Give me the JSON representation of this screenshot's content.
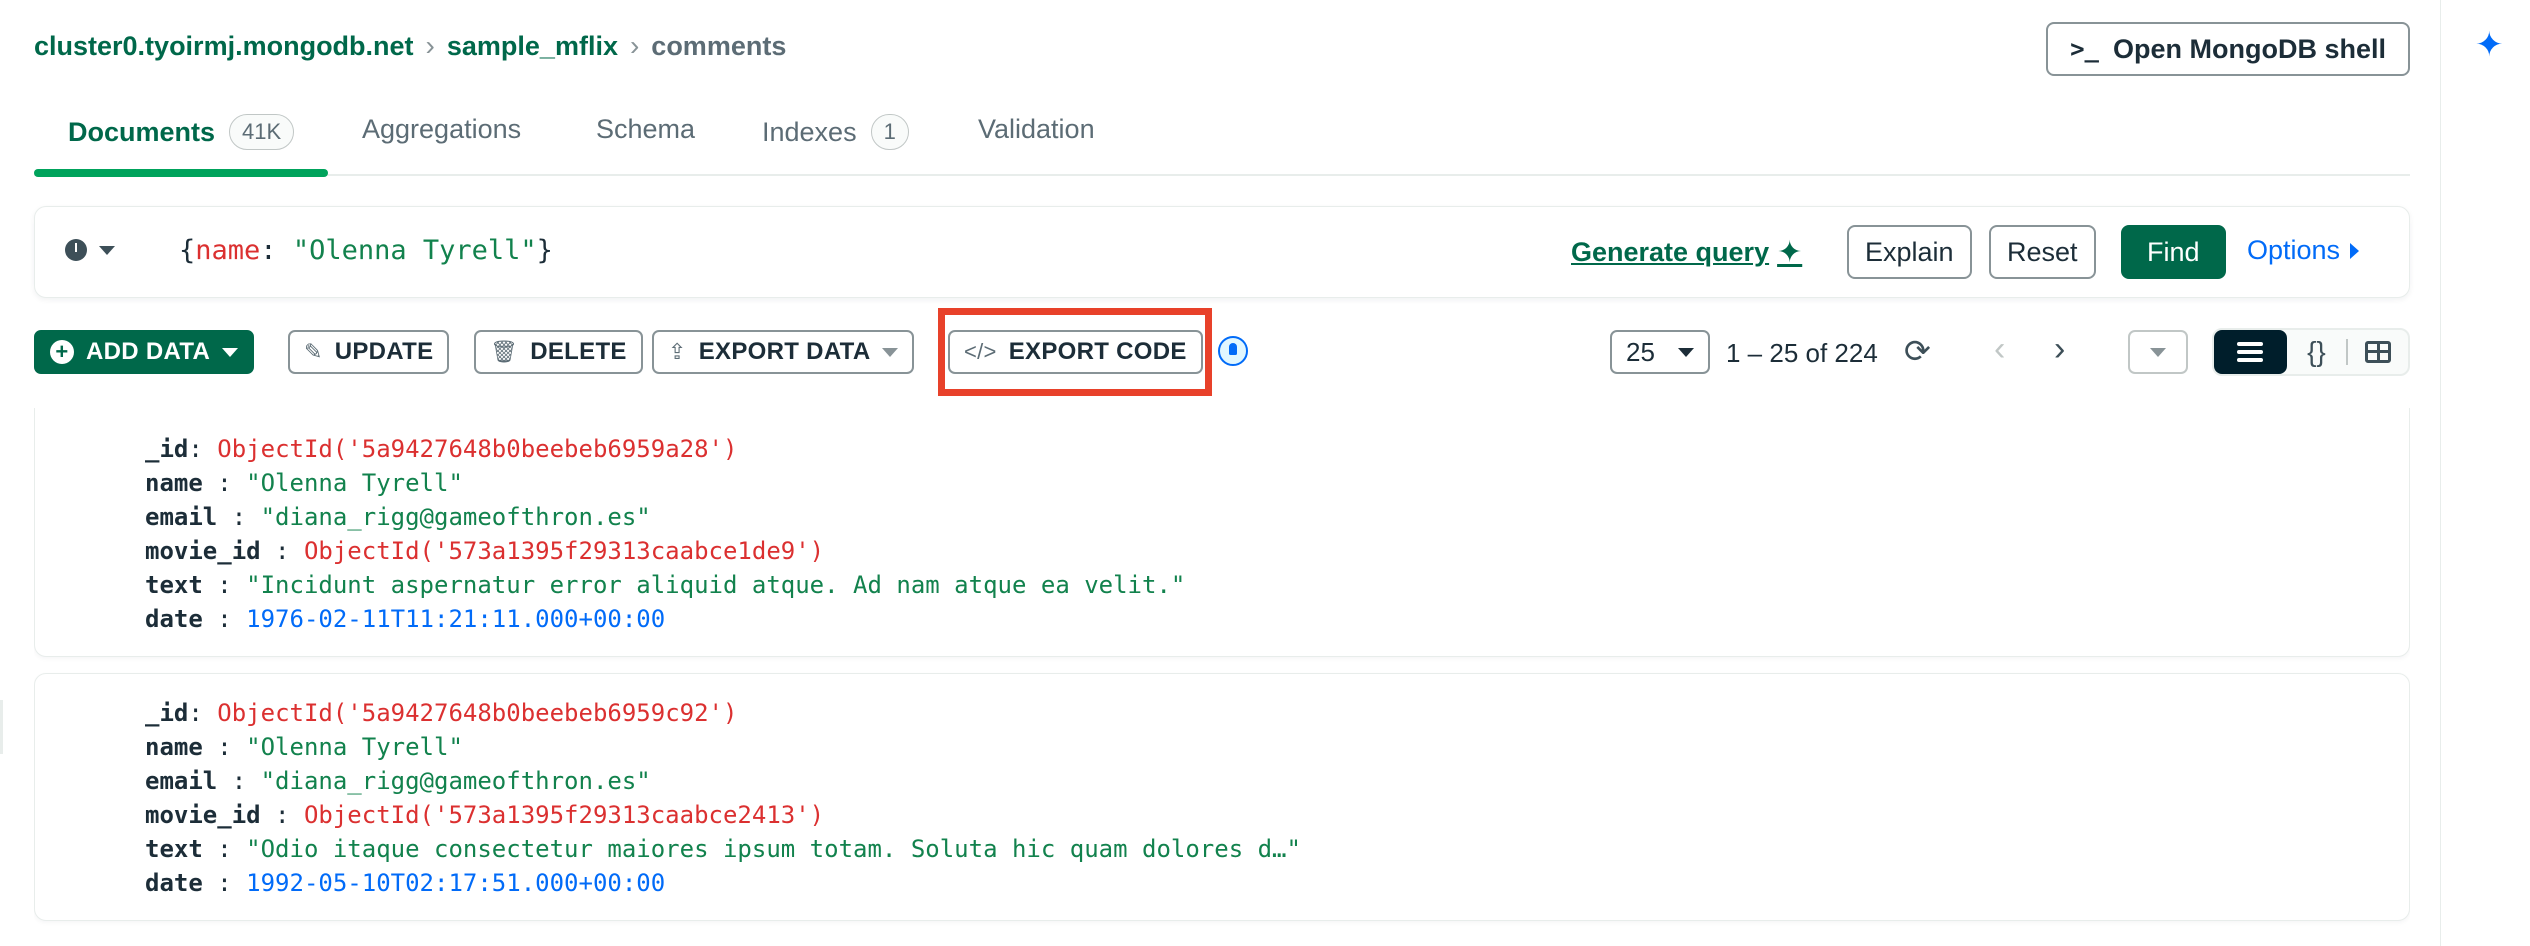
{
  "breadcrumb": {
    "cluster": "cluster0.tyoirmj.mongodb.net",
    "database": "sample_mflix",
    "collection": "comments"
  },
  "header": {
    "shell_prompt": ">_",
    "shell_label": "Open MongoDB shell"
  },
  "tabs": [
    {
      "label": "Documents",
      "badge": "41K",
      "active": true
    },
    {
      "label": "Aggregations"
    },
    {
      "label": "Schema"
    },
    {
      "label": "Indexes",
      "badge": "1"
    },
    {
      "label": "Validation"
    }
  ],
  "query": {
    "open_brace": "{",
    "key": "name",
    "sep": ": ",
    "value": "\"Olenna Tyrell\"",
    "close_brace": "}",
    "generate_label": "Generate query",
    "explain_label": "Explain",
    "reset_label": "Reset",
    "find_label": "Find",
    "options_label": "Options"
  },
  "toolbar": {
    "add_data_label": "ADD DATA",
    "update_label": "UPDATE",
    "delete_label": "DELETE",
    "export_data_label": "EXPORT DATA",
    "export_code_label": "EXPORT CODE",
    "page_size": "25",
    "range_text": "1 – 25 of 224"
  },
  "colors": {
    "brand_green": "#00684a",
    "highlight": "#e8412a",
    "link_blue": "#016bf8"
  },
  "documents": [
    {
      "fields": [
        {
          "key": "_id",
          "sep": ": ",
          "value": "ObjectId('5a9427648b0beebeb6959a28')",
          "type": "oid"
        },
        {
          "key": "name",
          "sep": " : ",
          "value": "\"Olenna Tyrell\"",
          "type": "str"
        },
        {
          "key": "email",
          "sep": " : ",
          "value": "\"diana_rigg@gameofthron.es\"",
          "type": "str"
        },
        {
          "key": "movie_id",
          "sep": " : ",
          "value": "ObjectId('573a1395f29313caabce1de9')",
          "type": "oid"
        },
        {
          "key": "text",
          "sep": " : ",
          "value": "\"Incidunt aspernatur error aliquid atque. Ad nam atque ea velit.\"",
          "type": "str"
        },
        {
          "key": "date",
          "sep": " : ",
          "value": "1976-02-11T11:21:11.000+00:00",
          "type": "date"
        }
      ]
    },
    {
      "fields": [
        {
          "key": "_id",
          "sep": ": ",
          "value": "ObjectId('5a9427648b0beebeb6959c92')",
          "type": "oid"
        },
        {
          "key": "name",
          "sep": " : ",
          "value": "\"Olenna Tyrell\"",
          "type": "str"
        },
        {
          "key": "email",
          "sep": " : ",
          "value": "\"diana_rigg@gameofthron.es\"",
          "type": "str"
        },
        {
          "key": "movie_id",
          "sep": " : ",
          "value": "ObjectId('573a1395f29313caabce2413')",
          "type": "oid"
        },
        {
          "key": "text",
          "sep": " : ",
          "value": "\"Odio itaque consectetur maiores ipsum totam. Soluta hic quam dolores d…\"",
          "type": "str"
        },
        {
          "key": "date",
          "sep": " : ",
          "value": "1992-05-10T02:17:51.000+00:00",
          "type": "date"
        }
      ]
    }
  ]
}
